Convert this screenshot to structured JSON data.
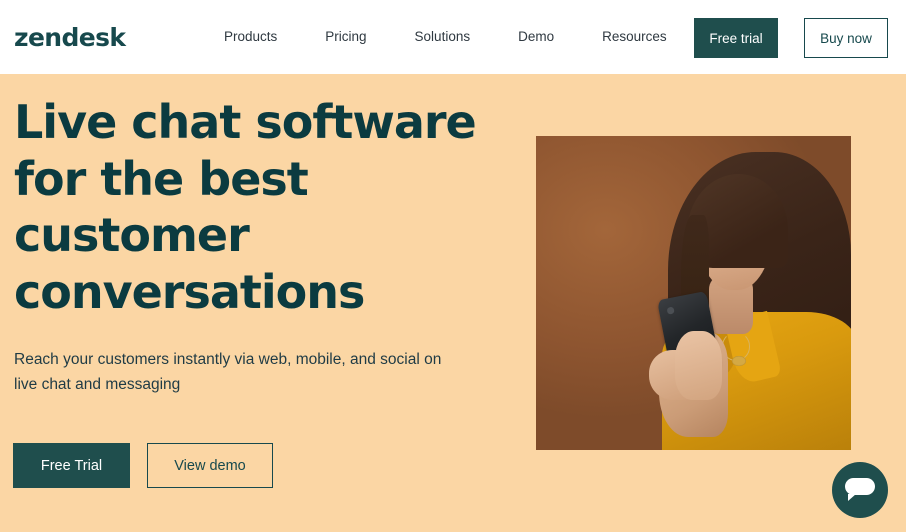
{
  "brand": {
    "logo_text": "zendesk",
    "logo_color": "#17494D"
  },
  "header": {
    "nav_items": [
      {
        "label": "Products"
      },
      {
        "label": "Pricing"
      },
      {
        "label": "Solutions"
      },
      {
        "label": "Demo"
      },
      {
        "label": "Resources"
      }
    ],
    "free_trial_label": "Free trial",
    "buy_now_label": "Buy now",
    "background": "#FFFFFF"
  },
  "hero": {
    "headline": "Live chat software for the best customer conversations",
    "subtext": "Reach your customers instantly via web, mobile, and social on live chat and messaging",
    "primary_cta_label": "Free Trial",
    "secondary_cta_label": "View demo",
    "background": "#FBD6A4",
    "heading_color": "#0B3B40",
    "accent_color": "#1F4E4D",
    "image_alt": "Woman with glasses in a yellow shirt looking at a smartphone against a brown background"
  },
  "chat_widget": {
    "icon": "chat-bubble-icon",
    "color": "#1F4E4D"
  }
}
